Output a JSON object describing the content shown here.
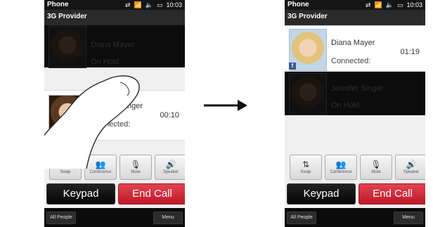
{
  "left_phone": {
    "status_title": "Phone",
    "status_time": "10:03",
    "provider": "3G Provider",
    "held_call": {
      "name": "Diana Mayer",
      "status": "On Hold"
    },
    "active_call": {
      "name": "Jennifer Singer",
      "status": "Connected:",
      "duration": "00:10"
    },
    "controls": [
      {
        "icon": "⇅",
        "label": "Swap"
      },
      {
        "icon": "👥",
        "label": "Conference"
      },
      {
        "icon": "🎙",
        "label": "Mute"
      },
      {
        "icon": "🔊",
        "label": "Speaker"
      }
    ],
    "keypad_label": "Keypad",
    "endcall_label": "End Call",
    "bottom_left": "All People",
    "bottom_right": "Menu"
  },
  "right_phone": {
    "status_title": "Phone",
    "status_time": "10:03",
    "provider": "3G Provider",
    "active_call": {
      "name": "Diana Mayer",
      "status": "Connected:",
      "duration": "01:19",
      "badge": "f"
    },
    "held_call": {
      "name": "Jennifer Singer",
      "status": "On Hold"
    },
    "controls": [
      {
        "icon": "⇅",
        "label": "Swap"
      },
      {
        "icon": "👥",
        "label": "Conference"
      },
      {
        "icon": "🎙",
        "label": "Mute"
      },
      {
        "icon": "🔊",
        "label": "Speaker"
      }
    ],
    "keypad_label": "Keypad",
    "endcall_label": "End Call",
    "bottom_left": "All People",
    "bottom_right": "Menu"
  },
  "icons": {
    "status": [
      "sync-icon",
      "signal-icon",
      "volume-icon",
      "battery-icon"
    ],
    "arrow": "right-arrow-icon",
    "gesture": "finger-swipe-icon"
  }
}
